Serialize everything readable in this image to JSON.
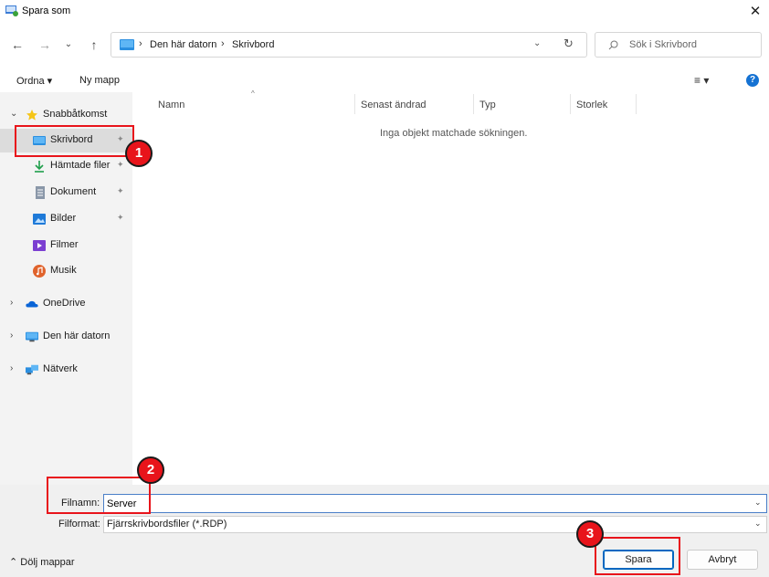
{
  "window": {
    "title": "Spara som",
    "close_symbol": "✕"
  },
  "nav": {
    "back_symbol": "←",
    "forward_symbol": "→",
    "recent_symbol": "⌄",
    "up_symbol": "↑"
  },
  "address": {
    "separator": "›",
    "crumbs": [
      "Den här datorn",
      "Skrivbord"
    ],
    "dropdown_symbol": "⌄",
    "refresh_symbol": "↻"
  },
  "search": {
    "placeholder": "Sök i Skrivbord"
  },
  "toolbar": {
    "ordna_label": "Ordna ▾",
    "new_folder_label": "Ny mapp",
    "view_symbol": "≡ ▾",
    "help_symbol": "?"
  },
  "sidebar": {
    "quick_access": {
      "label": "Snabbåtkomst",
      "chevron": "⌄"
    },
    "pin_symbol": "📌",
    "quick_items": [
      {
        "label": "Skrivbord",
        "icon": "desktop-icon",
        "pinned": true
      },
      {
        "label": "Hämtade filer",
        "icon": "download-icon",
        "pinned": true
      },
      {
        "label": "Dokument",
        "icon": "document-icon",
        "pinned": true
      },
      {
        "label": "Bilder",
        "icon": "pictures-icon",
        "pinned": true
      },
      {
        "label": "Filmer",
        "icon": "videos-icon",
        "pinned": false
      },
      {
        "label": "Musik",
        "icon": "music-icon",
        "pinned": false
      }
    ],
    "roots": [
      {
        "label": "OneDrive",
        "icon": "onedrive-icon",
        "chevron": "›"
      },
      {
        "label": "Den här datorn",
        "icon": "this-pc-icon",
        "chevron": "›"
      },
      {
        "label": "Nätverk",
        "icon": "network-icon",
        "chevron": "›"
      }
    ]
  },
  "file_list": {
    "sort_symbol": "^",
    "columns": [
      "Namn",
      "Senast ändrad",
      "Typ",
      "Storlek"
    ],
    "empty_message": "Inga objekt matchade sökningen."
  },
  "form": {
    "filename_label": "Filnamn:",
    "filename_value": "Server",
    "format_label": "Filformat:",
    "format_value": "Fjärrskrivbordsfiler (*.RDP)",
    "dropdown_symbol": "⌄"
  },
  "footer": {
    "hide_folders_label": "⌃  Dölj mappar",
    "save_label": "Spara",
    "cancel_label": "Avbryt"
  },
  "annotations": {
    "badge_1": "1",
    "badge_2": "2",
    "badge_3": "3",
    "color": "#e8141b"
  },
  "colors": {
    "accent": "#0067c0",
    "sidebar_bg": "#f3f3f3",
    "footer_bg": "#f0f0f0"
  }
}
